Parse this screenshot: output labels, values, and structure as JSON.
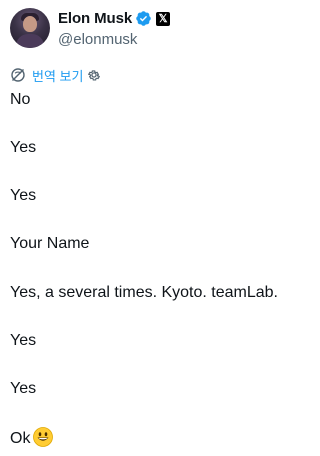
{
  "author": {
    "display_name": "Elon Musk",
    "handle": "@elonmusk"
  },
  "translate": {
    "label": "번역 보기"
  },
  "tweet": {
    "lines": [
      "No",
      "Yes",
      "Yes",
      "Your Name",
      "Yes, a several times. Kyoto. teamLab.",
      "Yes",
      "Yes",
      "Ok"
    ]
  },
  "colors": {
    "accent": "#1d9bf0",
    "text": "#0f1419",
    "muted": "#536471"
  },
  "icons": {
    "verified": "verified-badge-icon",
    "affiliate": "x-logo-icon",
    "translate": "translate-globe-icon",
    "settings": "gear-icon",
    "emoji": "grinning-face-emoji"
  }
}
